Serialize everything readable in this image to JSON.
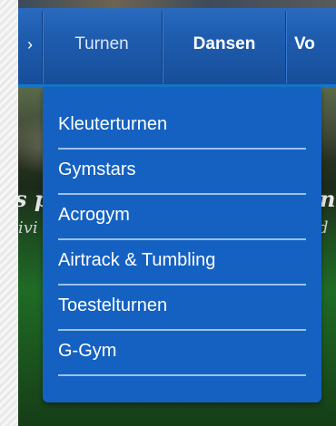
{
  "navbar": {
    "items": [
      {
        "label": "Turnen"
      },
      {
        "label": "Dansen"
      },
      {
        "label": "Vo"
      }
    ]
  },
  "hero": {
    "left_line1": "s p",
    "left_line2": "ivi",
    "right_line1": "n",
    "right_line2": "d"
  },
  "dropdown": {
    "items": [
      {
        "label": "Kleuterturnen"
      },
      {
        "label": "Gymstars"
      },
      {
        "label": "Acrogym"
      },
      {
        "label": "Airtrack & Tumbling"
      },
      {
        "label": "Toestelturnen"
      },
      {
        "label": "G-Gym"
      }
    ]
  },
  "colors": {
    "navbar_blue": "#1f5db0",
    "dropdown_blue": "#1461c1",
    "divider": "#9cc0ec",
    "text": "#ffffff"
  }
}
